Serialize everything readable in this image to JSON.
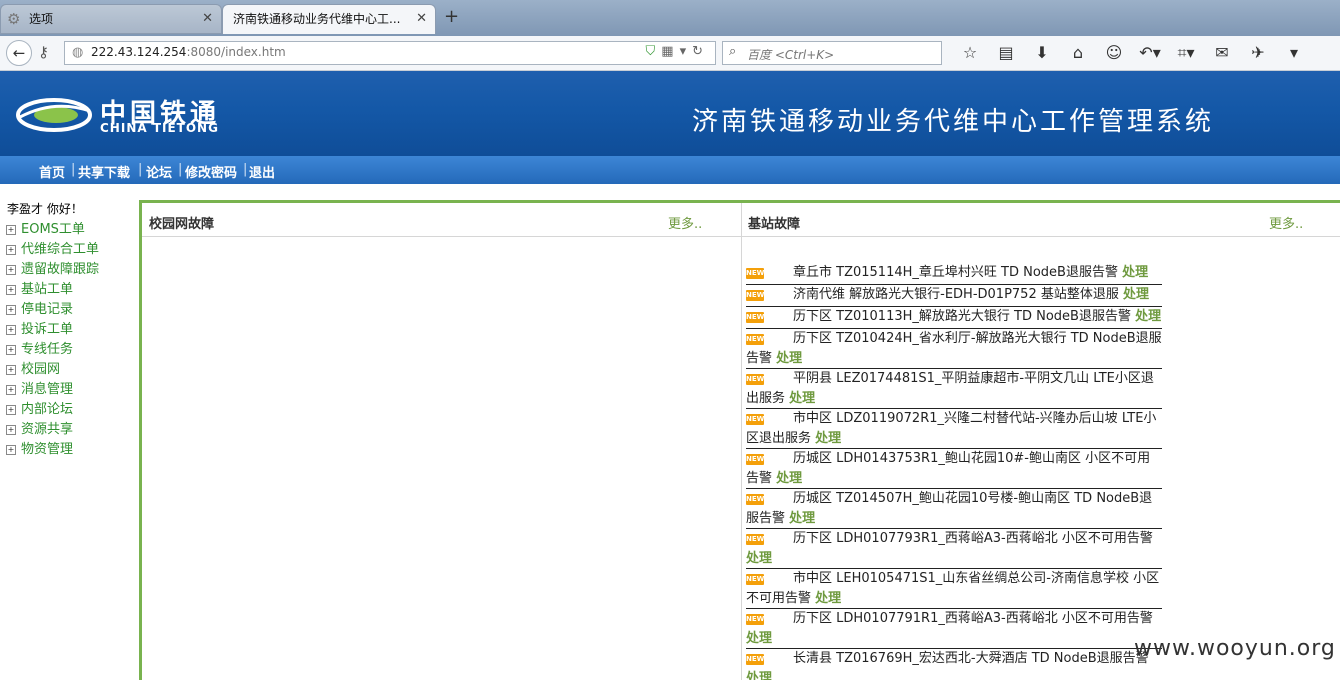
{
  "browser": {
    "tabs": [
      {
        "label": "选项",
        "active": false
      },
      {
        "label": "济南铁通移动业务代维中心工...",
        "active": true
      }
    ],
    "url_host": "222.43.124.254",
    "url_path": ":8080/index.htm",
    "search_placeholder": "百度 <Ctrl+K>"
  },
  "header": {
    "logo_cn": "中国铁通",
    "logo_en": "CHINA TIETONG",
    "system_title": "济南铁通移动业务代维中心工作管理系统"
  },
  "menu": [
    "首页",
    "共享下载",
    "论坛",
    "修改密码",
    "退出"
  ],
  "sidebar": {
    "greeting": "李盈才  你好！",
    "items": [
      "EOMS工单",
      "代维综合工单",
      "遗留故障跟踪",
      "基站工单",
      "停电记录",
      "投诉工单",
      "专线任务",
      "校园网",
      "消息管理",
      "内部论坛",
      "资源共享",
      "物资管理"
    ]
  },
  "panels": {
    "campus": {
      "title": "校园网故障",
      "more": "更多.."
    },
    "station": {
      "title": "基站故障",
      "more": "更多.."
    }
  },
  "new_badge": "NEW",
  "alarms": [
    {
      "text": "章丘市 TZ015114H_章丘埠村兴旺 TD NodeB退服告警",
      "action": "处理"
    },
    {
      "text": "济南代维 解放路光大银行-EDH-D01P752 基站整体退服",
      "action": "处理"
    },
    {
      "text": "历下区 TZ010113H_解放路光大银行 TD NodeB退服告警",
      "action": "处理"
    },
    {
      "text": "历下区 TZ010424H_省水利厅-解放路光大银行 TD NodeB退服告警",
      "action": "处理"
    },
    {
      "text": "平阴县 LEZ0174481S1_平阴益康超市-平阴文几山 LTE小区退出服务",
      "action": "处理"
    },
    {
      "text": "市中区 LDZ0119072R1_兴隆二村替代站-兴隆办后山坡 LTE小区退出服务",
      "action": "处理"
    },
    {
      "text": "历城区 LDH0143753R1_鲍山花园10#-鲍山南区 小区不可用告警",
      "action": "处理"
    },
    {
      "text": "历城区 TZ014507H_鲍山花园10号楼-鲍山南区 TD NodeB退服告警",
      "action": "处理"
    },
    {
      "text": "历下区 LDH0107793R1_西蒋峪A3-西蒋峪北 小区不可用告警",
      "action": "处理"
    },
    {
      "text": "市中区 LEH0105471S1_山东省丝绸总公司-济南信息学校 小区不可用告警",
      "action": "处理"
    },
    {
      "text": "历下区 LDH0107791R1_西蒋峪A3-西蒋峪北 小区不可用告警",
      "action": "处理"
    },
    {
      "text": "长清县 TZ016769H_宏达西北-大舜酒店 TD NodeB退服告警",
      "action": "处理"
    }
  ],
  "watermark": "www.wooyun.org",
  "colors": {
    "header_blue": "#1458a7",
    "menu_blue": "#2c72c2",
    "accent_green": "#79b34f",
    "link_green": "#6f9a3f",
    "badge_orange": "#f4a00a"
  }
}
